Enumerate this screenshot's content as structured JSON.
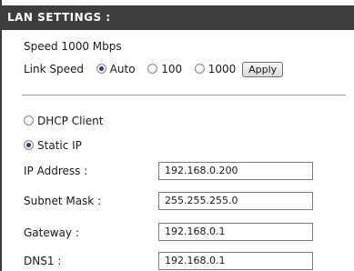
{
  "section": {
    "title": "LAN SETTINGS :"
  },
  "speed": {
    "status_text": "Speed 1000 Mbps",
    "link_speed_label": "Link Speed",
    "options": [
      {
        "label": "Auto",
        "selected": true
      },
      {
        "label": "100",
        "selected": false
      },
      {
        "label": "1000",
        "selected": false
      }
    ],
    "apply_label": "Apply"
  },
  "addressing": {
    "options": [
      {
        "label": "DHCP Client",
        "selected": false
      },
      {
        "label": "Static IP",
        "selected": true
      }
    ]
  },
  "fields": {
    "ip_address": {
      "label": "IP Address :",
      "value": "192.168.0.200"
    },
    "subnet_mask": {
      "label": "Subnet Mask :",
      "value": "255.255.255.0"
    },
    "gateway": {
      "label": "Gateway :",
      "value": "192.168.0.1"
    },
    "dns1": {
      "label": "DNS1 :",
      "value": "192.168.0.1"
    }
  },
  "colors": {
    "title_bar": "#3d3d3d",
    "radio_selected": "#1f3f8f"
  }
}
